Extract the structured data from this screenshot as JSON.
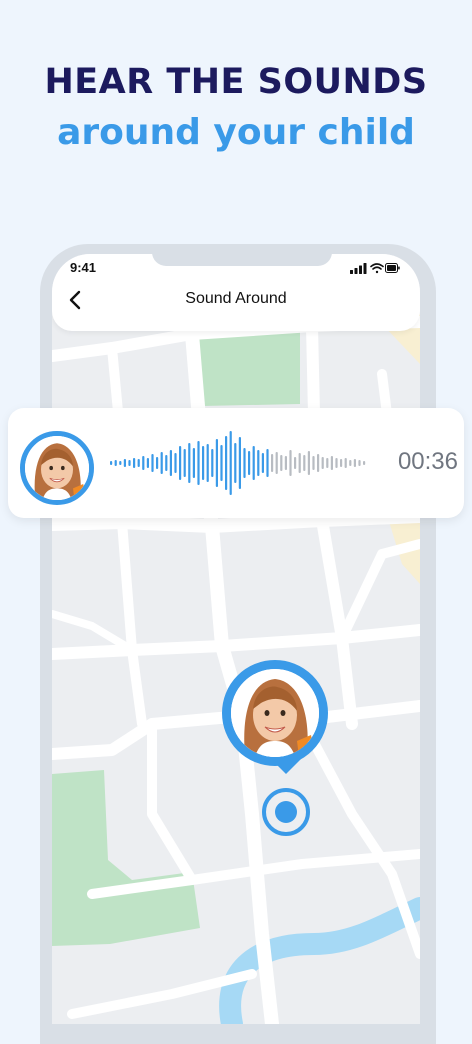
{
  "headline": {
    "line1": "HEAR THE SOUNDS",
    "line2": "around your child"
  },
  "status_bar": {
    "time": "9:41",
    "icons": [
      "signal-icon",
      "wifi-icon",
      "battery-icon"
    ]
  },
  "app_bar": {
    "back_icon": "chevron-left-icon",
    "title": "Sound Around"
  },
  "sound_card": {
    "avatar": "child-avatar",
    "duration": "00:36",
    "played_color": "#3a9ae8",
    "unplayed_color": "#b8bcc2"
  },
  "map": {
    "location_pin": "child-location-pin",
    "colors": {
      "road": "#ffffff",
      "block": "#eceef1",
      "park": "#bfe3c6",
      "water": "#a6d9f5",
      "sand": "#f8efd2"
    }
  },
  "colors": {
    "accent": "#3a9ae8",
    "headline_dark": "#1c1a5e",
    "background": "#eef5fd"
  }
}
